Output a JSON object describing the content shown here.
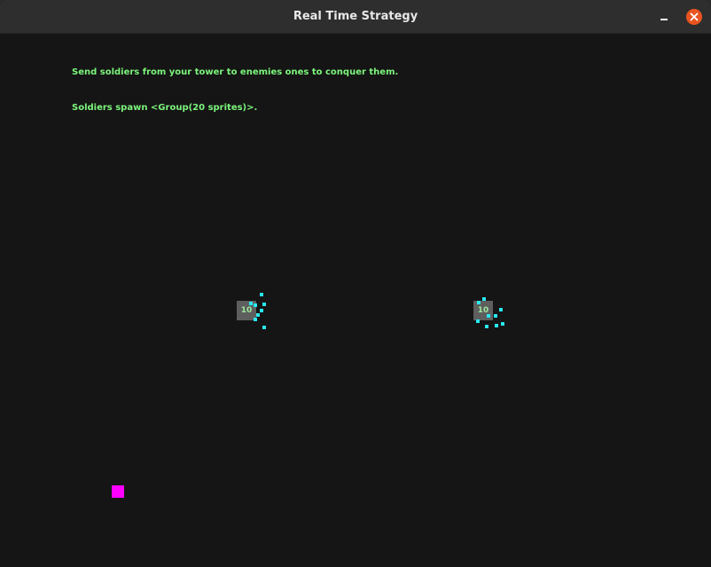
{
  "window": {
    "title": "Real Time Strategy"
  },
  "game": {
    "instructions": "Send soldiers from your tower to enemies ones to conquer them.",
    "spawn_info": "Soldiers spawn <Group(20 sprites)>.",
    "towers": [
      {
        "count": "10"
      },
      {
        "count": "10"
      }
    ],
    "colors": {
      "background": "#151515",
      "text": "#7cf57c",
      "tower": "#5e5e5e",
      "soldier": "#29e8f0",
      "selected_unit": "#ff00ff",
      "close_button": "#e95420"
    }
  }
}
